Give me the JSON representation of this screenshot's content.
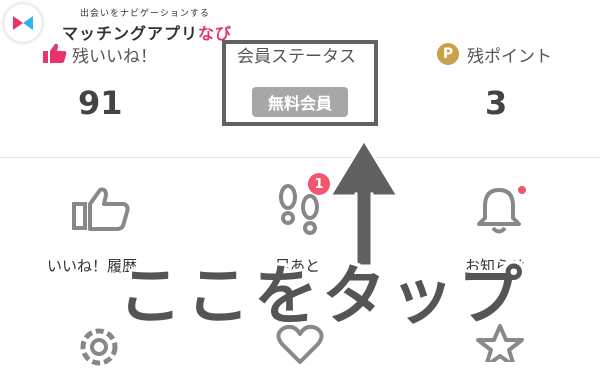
{
  "header": {
    "tagline": "出会いをナビゲーションする",
    "brand_main": "マッチングアプリ",
    "brand_accent": "なび"
  },
  "stats": {
    "likes": {
      "label": "残いいね！",
      "value": "91",
      "icon": "thumbs-up-icon"
    },
    "status": {
      "label": "会員ステータス",
      "badge": "無料会員"
    },
    "points": {
      "label": "残ポイント",
      "value": "3",
      "icon": "p-coin-icon",
      "coin_letter": "P"
    }
  },
  "menu": {
    "likes_history": {
      "label": "いいね！履歴",
      "icon": "thumbs-up-outline-icon"
    },
    "footprints": {
      "label": "足あと",
      "icon": "footprints-icon",
      "badge_count": "1"
    },
    "notifications": {
      "label": "お知らせ",
      "icon": "bell-icon"
    },
    "settings": {
      "icon": "gear-icon"
    },
    "favorites": {
      "icon": "heart-icon"
    },
    "starred": {
      "icon": "star-icon"
    }
  },
  "overlay": {
    "callout": "ここをタップ"
  },
  "colors": {
    "accent_pink": "#e8336b",
    "badge_red": "#f0566e",
    "coin_gold": "#c9a14a",
    "status_badge": "#a7a7a7",
    "overlay_gray": "#616161"
  }
}
